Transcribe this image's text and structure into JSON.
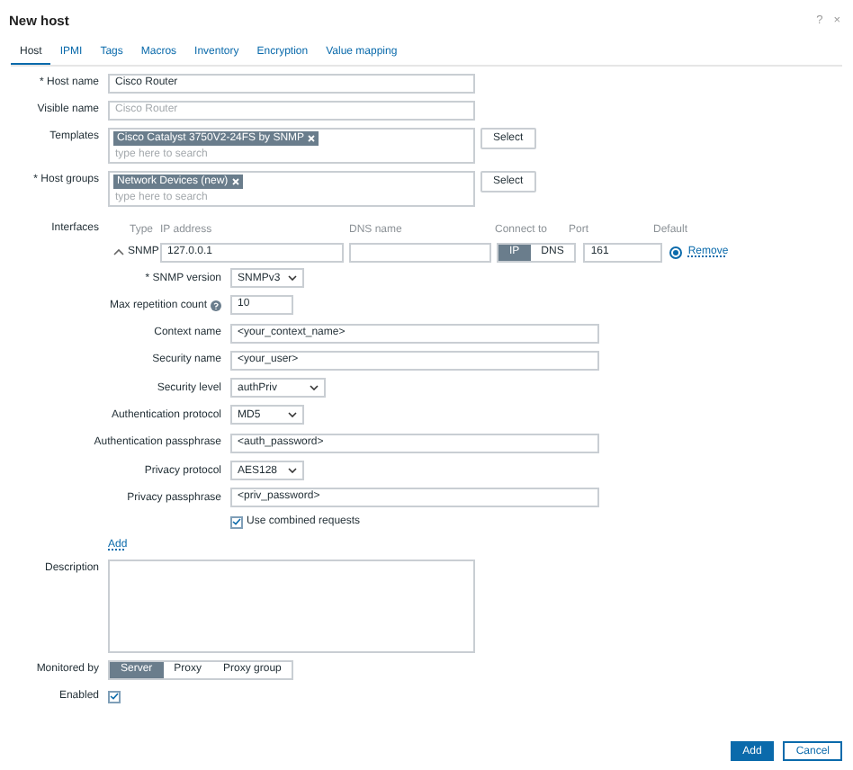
{
  "dialog": {
    "title": "New host",
    "help": "?",
    "close": "×"
  },
  "tabs": [
    {
      "label": "Host",
      "selected": true
    },
    {
      "label": "IPMI",
      "selected": false
    },
    {
      "label": "Tags",
      "selected": false
    },
    {
      "label": "Macros",
      "selected": false
    },
    {
      "label": "Inventory",
      "selected": false
    },
    {
      "label": "Encryption",
      "selected": false
    },
    {
      "label": "Value mapping",
      "selected": false
    }
  ],
  "fields": [
    {
      "kind": "text",
      "label": "* Host name",
      "value": "Cisco Router"
    },
    {
      "kind": "text",
      "label": "Visible name",
      "placeholder": "Cisco Router"
    },
    {
      "kind": "multiselect",
      "label": "Templates",
      "tags": [
        "Cisco Catalyst 3750V2-24FS by SNMP"
      ],
      "placeholder": "type here to search",
      "button": "Select"
    },
    {
      "kind": "multiselect",
      "label": "* Host groups",
      "tags": [
        "Network Devices (new)"
      ],
      "placeholder": "type here to search",
      "button": "Select"
    }
  ],
  "interfaces": {
    "label": "Interfaces",
    "columns": [
      "Type",
      "IP address",
      "DNS name",
      "Connect to",
      "Port",
      "Default"
    ],
    "rows": [
      {
        "expanded": true,
        "type": "SNMP",
        "ip": "127.0.0.1",
        "connect": [
          {
            "label": "IP",
            "selected": true
          },
          {
            "label": "DNS",
            "selected": false
          }
        ],
        "port": "161",
        "default": true,
        "remove": "Remove"
      }
    ],
    "snmp": [
      {
        "kind": "select",
        "label": "* SNMP version",
        "value": "SNMPv3"
      },
      {
        "kind": "number",
        "label": "Max repetition count",
        "value": "10",
        "hint": true
      },
      {
        "kind": "text",
        "label": "Context name",
        "value": "<your_context_name>"
      },
      {
        "kind": "text",
        "label": "Security name",
        "value": "<your_user>"
      },
      {
        "kind": "select-wide",
        "label": "Security level",
        "value": "authPriv"
      },
      {
        "kind": "select",
        "label": "Authentication protocol",
        "value": "MD5"
      },
      {
        "kind": "text",
        "label": "Authentication passphrase",
        "value": "<auth_password>"
      },
      {
        "kind": "select",
        "label": "Privacy protocol",
        "value": "AES128"
      },
      {
        "kind": "text",
        "label": "Privacy passphrase",
        "value": "<priv_password>"
      },
      {
        "kind": "checkbox",
        "label": "Use combined requests",
        "checked": true
      }
    ],
    "add": "Add"
  },
  "description": {
    "label": "Description"
  },
  "monitored_by": {
    "label": "Monitored by",
    "options": [
      {
        "label": "Server",
        "selected": true
      },
      {
        "label": "Proxy",
        "selected": false
      },
      {
        "label": "Proxy group",
        "selected": false
      }
    ]
  },
  "enabled": {
    "label": "Enabled",
    "checked": true
  },
  "buttons": [
    {
      "label": "Add",
      "primary": true
    },
    {
      "label": "Cancel",
      "primary": false
    }
  ]
}
